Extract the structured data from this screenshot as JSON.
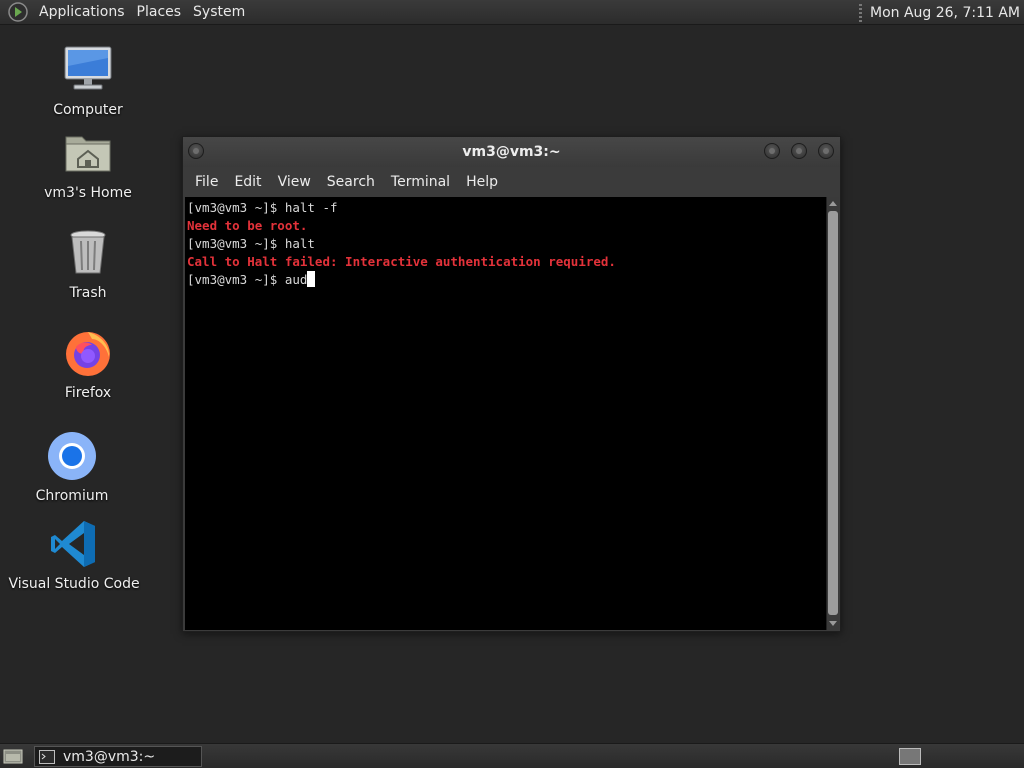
{
  "top_panel": {
    "menus": [
      "Applications",
      "Places",
      "System"
    ],
    "clock": "Mon Aug 26,  7:11 AM"
  },
  "desktop": {
    "icons": [
      {
        "label": "Computer",
        "icon": "computer-icon"
      },
      {
        "label": "vm3's Home",
        "icon": "home-folder-icon"
      },
      {
        "label": "Trash",
        "icon": "trash-icon"
      },
      {
        "label": "Firefox",
        "icon": "firefox-icon"
      },
      {
        "label": "Chromium",
        "icon": "chromium-icon"
      },
      {
        "label": "Visual Studio Code",
        "icon": "vscode-icon"
      }
    ]
  },
  "terminal": {
    "title": "vm3@vm3:~",
    "menu": [
      "File",
      "Edit",
      "View",
      "Search",
      "Terminal",
      "Help"
    ],
    "lines": [
      {
        "text": "[vm3@vm3 ~]$ halt -f",
        "style": "normal"
      },
      {
        "text": "Need to be root.",
        "style": "error"
      },
      {
        "text": "[vm3@vm3 ~]$ halt",
        "style": "normal"
      },
      {
        "text": "Call to Halt failed: Interactive authentication required.",
        "style": "error"
      },
      {
        "text": "[vm3@vm3 ~]$ aud",
        "style": "prompt-with-cursor"
      }
    ]
  },
  "taskbar": {
    "task_label": "vm3@vm3:~"
  },
  "colors": {
    "desktop_bg": "#262626",
    "terminal_bg": "#000000",
    "error_text": "#e3323a"
  }
}
